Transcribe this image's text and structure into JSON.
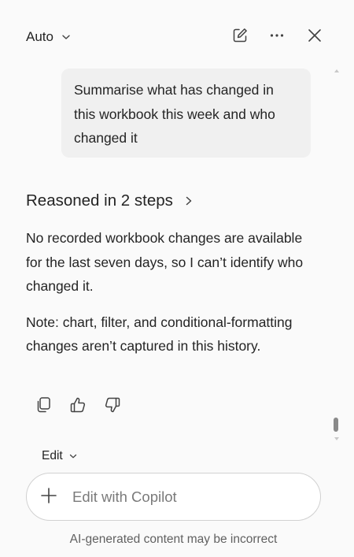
{
  "header": {
    "mode_label": "Auto",
    "icons": {
      "mode_chevron": "chevron-down-icon",
      "new_chat": "compose-icon",
      "more": "more-horizontal-icon",
      "close": "close-icon"
    }
  },
  "conversation": {
    "user_prompt": "Summarise what has changed in this workbook this week and who changed it",
    "reasoning_label": "Reasoned in 2 steps",
    "response_paragraphs": [
      "No recorded workbook changes are available for the last seven days, so I can’t identify who changed it.",
      "Note: chart, filter, and conditional-formatting changes aren’t captured in this history."
    ],
    "feedback_icons": [
      "copy-icon",
      "thumbs-up-icon",
      "thumbs-down-icon"
    ]
  },
  "composer": {
    "mode_label": "Edit",
    "input_value": "",
    "placeholder": "Edit with Copilot",
    "plus_icon": "plus-icon"
  },
  "footer": {
    "disclaimer": "AI-generated content may be incorrect"
  },
  "colors": {
    "pane_background": "#fafafa",
    "bubble_background": "#f0f0f0",
    "text_primary": "#242424",
    "text_secondary": "#616161",
    "placeholder": "#7a7a7a",
    "input_border": "#d1d1d1"
  }
}
